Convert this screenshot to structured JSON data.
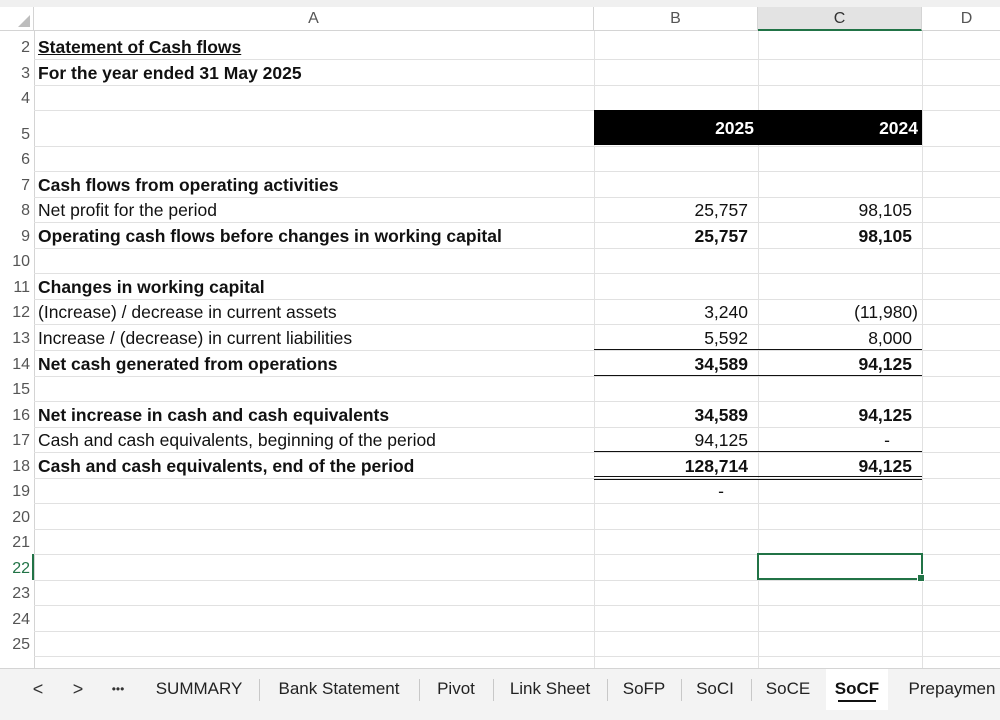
{
  "columns": [
    {
      "letter": "A"
    },
    {
      "letter": "B"
    },
    {
      "letter": "C"
    },
    {
      "letter": "D"
    }
  ],
  "rows": [
    {
      "num": "2",
      "a": "Statement of Cash flows",
      "b": "",
      "c": ""
    },
    {
      "num": "3",
      "a": "For the year ended 31 May 2025",
      "b": "",
      "c": ""
    },
    {
      "num": "4",
      "a": "",
      "b": "",
      "c": ""
    },
    {
      "num": "5",
      "a": "",
      "b": "2025",
      "c": "2024"
    },
    {
      "num": "6",
      "a": "",
      "b": "",
      "c": ""
    },
    {
      "num": "7",
      "a": "Cash flows from operating activities",
      "b": "",
      "c": ""
    },
    {
      "num": "8",
      "a": "Net profit for the period",
      "b": "25,757",
      "c": "98,105"
    },
    {
      "num": "9",
      "a": "Operating cash flows before changes in working capital",
      "b": "25,757",
      "c": "98,105"
    },
    {
      "num": "10",
      "a": "",
      "b": "",
      "c": ""
    },
    {
      "num": "11",
      "a": "Changes in working capital",
      "b": "",
      "c": ""
    },
    {
      "num": "12",
      "a": "(Increase) / decrease in current assets",
      "b": "3,240",
      "c": "(11,980)"
    },
    {
      "num": "13",
      "a": "Increase / (decrease) in current liabilities",
      "b": "5,592",
      "c": "8,000"
    },
    {
      "num": "14",
      "a": "Net cash generated from operations",
      "b": "34,589",
      "c": "94,125"
    },
    {
      "num": "15",
      "a": "",
      "b": "",
      "c": ""
    },
    {
      "num": "16",
      "a": "Net increase in cash and cash equivalents",
      "b": "34,589",
      "c": "94,125"
    },
    {
      "num": "17",
      "a": "Cash and cash equivalents, beginning of the period",
      "b": "94,125",
      "c": "-"
    },
    {
      "num": "18",
      "a": "Cash and cash equivalents, end of the period",
      "b": "128,714",
      "c": "94,125"
    },
    {
      "num": "19",
      "a": "",
      "b": "-",
      "c": ""
    },
    {
      "num": "20",
      "a": "",
      "b": "",
      "c": ""
    },
    {
      "num": "21",
      "a": "",
      "b": "",
      "c": ""
    },
    {
      "num": "22",
      "a": "",
      "b": "",
      "c": ""
    },
    {
      "num": "23",
      "a": "",
      "b": "",
      "c": ""
    },
    {
      "num": "24",
      "a": "",
      "b": "",
      "c": ""
    },
    {
      "num": "25",
      "a": "",
      "b": "",
      "c": ""
    }
  ],
  "tabs": {
    "prev": "<",
    "next": ">",
    "more": "•••",
    "items": [
      "SUMMARY",
      "Bank Statement",
      "Pivot",
      "Link Sheet",
      "SoFP",
      "SoCI",
      "SoCE",
      "SoCF",
      "Prepaymen"
    ],
    "active": "SoCF"
  },
  "colors": {
    "accent": "#217346",
    "header_fill": "#000000"
  }
}
